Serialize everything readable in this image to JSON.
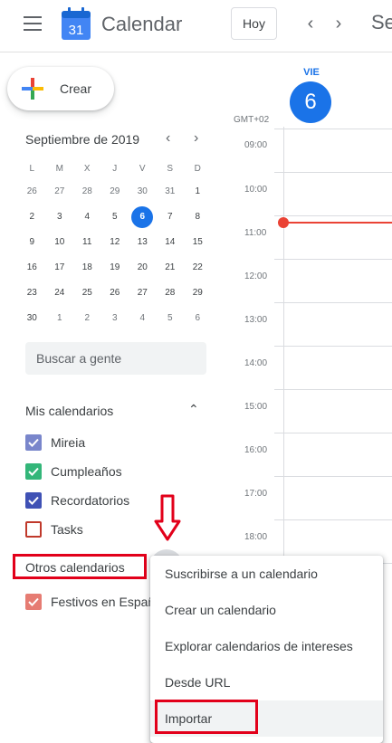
{
  "header": {
    "app_title": "Calendar",
    "logo_day": "31",
    "today_label": "Hoy",
    "date_range": "Se"
  },
  "create": {
    "label": "Crear"
  },
  "mini_calendar": {
    "title": "Septiembre de 2019",
    "weekdays": [
      "L",
      "M",
      "X",
      "J",
      "V",
      "S",
      "D"
    ],
    "weeks": [
      [
        "26",
        "27",
        "28",
        "29",
        "30",
        "31",
        "1"
      ],
      [
        "2",
        "3",
        "4",
        "5",
        "6",
        "7",
        "8"
      ],
      [
        "9",
        "10",
        "11",
        "12",
        "13",
        "14",
        "15"
      ],
      [
        "16",
        "17",
        "18",
        "19",
        "20",
        "21",
        "22"
      ],
      [
        "23",
        "24",
        "25",
        "26",
        "27",
        "28",
        "29"
      ],
      [
        "30",
        "1",
        "2",
        "3",
        "4",
        "5",
        "6"
      ]
    ],
    "today": "6"
  },
  "search_people": {
    "placeholder": "Buscar a gente"
  },
  "my_calendars": {
    "title": "Mis calendarios",
    "items": [
      {
        "label": "Mireia",
        "color": "#7986cb",
        "checked": true
      },
      {
        "label": "Cumpleaños",
        "color": "#33b679",
        "checked": true
      },
      {
        "label": "Recordatorios",
        "color": "#3f51b5",
        "checked": true
      },
      {
        "label": "Tasks",
        "color": "#c0392b",
        "checked": false
      }
    ]
  },
  "other_calendars": {
    "title": "Otros calendarios",
    "items": [
      {
        "label": "Festivos en España",
        "color": "#e67c73",
        "checked": true
      }
    ]
  },
  "day_view": {
    "timezone": "GMT+02",
    "day_name": "VIE",
    "day_number": "6",
    "hours": [
      "09:00",
      "10:00",
      "11:00",
      "12:00",
      "13:00",
      "14:00",
      "15:00",
      "16:00",
      "17:00",
      "18:00"
    ]
  },
  "context_menu": {
    "items": [
      "Suscribirse a un calendario",
      "Crear un calendario",
      "Explorar calendarios de intereses",
      "Desde URL",
      "Importar"
    ]
  },
  "colors": {
    "accent": "#1a73e8",
    "highlight": "#e2001a",
    "now_line": "#ea4335"
  }
}
